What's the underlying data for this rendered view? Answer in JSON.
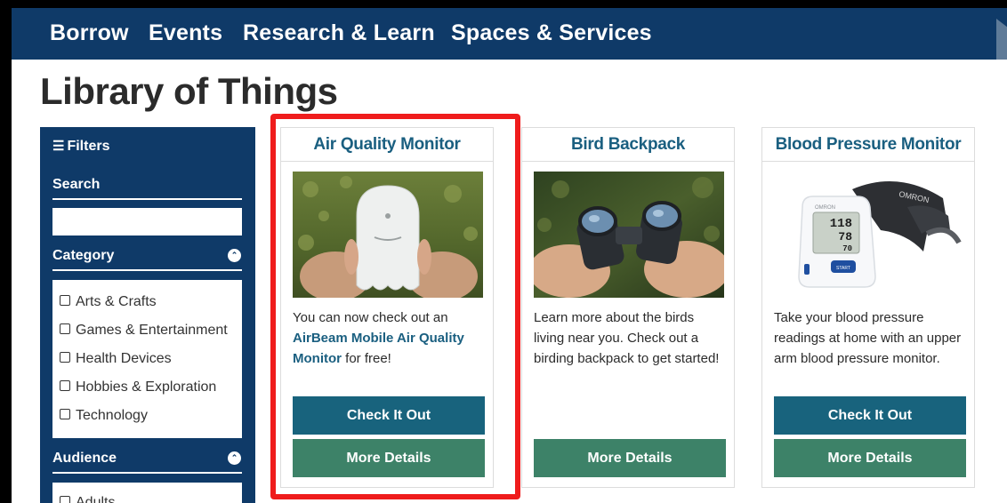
{
  "nav": {
    "items": [
      "Borrow",
      "Events",
      "Research & Learn",
      "Spaces & Services"
    ]
  },
  "page_title": "Library of Things",
  "sidebar": {
    "filters_label": "Filters",
    "filters_icon": "list-icon",
    "search_label": "Search",
    "search_value": "",
    "category_label": "Category",
    "category_options": [
      "Arts & Crafts",
      "Games & Entertainment",
      "Health Devices",
      "Hobbies & Exploration",
      "Technology"
    ],
    "audience_label": "Audience",
    "audience_options": [
      "Adults"
    ]
  },
  "cards": [
    {
      "title": "Air Quality Monitor",
      "desc_before": "You can now check out an ",
      "desc_link": "AirBeam Mobile Air Quality Monitor",
      "desc_after": " for free!",
      "checkout_label": "Check It Out",
      "details_label": "More Details"
    },
    {
      "title": "Bird Backpack",
      "desc": "Learn more about the birds living near you. Check out a birding backpack to get started!",
      "details_label": "More Details"
    },
    {
      "title": "Blood Pressure Monitor",
      "desc": "Take your blood pressure readings at home with an upper arm blood pressure monitor.",
      "checkout_label": "Check It Out",
      "details_label": "More Details",
      "image_brand": "OMRON",
      "image_readings": [
        "118",
        "78",
        "70"
      ],
      "image_start_label": "START"
    }
  ],
  "colors": {
    "navy": "#0f3a68",
    "title_blue": "#1a5f80",
    "checkout_teal": "#18637d",
    "details_green": "#3d8268",
    "highlight_red": "#ef1c1c"
  }
}
